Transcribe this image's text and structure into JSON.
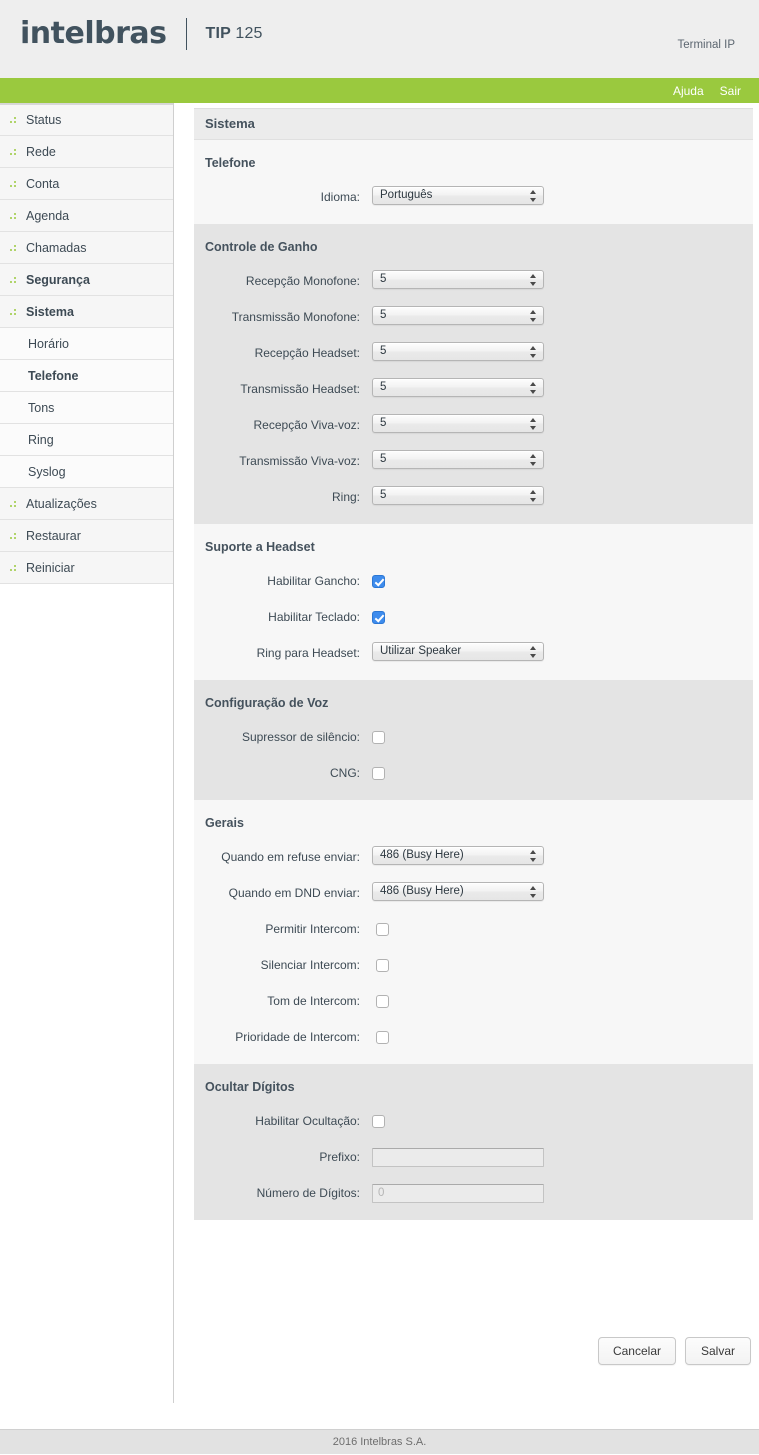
{
  "header": {
    "logo": "intelbras",
    "model_prefix": "TIP",
    "model_number": "125",
    "terminal_label": "Terminal IP"
  },
  "topbar": {
    "help_label": "Ajuda",
    "logout_label": "Sair",
    "accent_color": "#9ac93e"
  },
  "sidebar": {
    "items": [
      {
        "label": "Status",
        "sub": false,
        "active": false
      },
      {
        "label": "Rede",
        "sub": false,
        "active": false
      },
      {
        "label": "Conta",
        "sub": false,
        "active": false
      },
      {
        "label": "Agenda",
        "sub": false,
        "active": false
      },
      {
        "label": "Chamadas",
        "sub": false,
        "active": false
      },
      {
        "label": "Segurança",
        "sub": false,
        "active": true
      },
      {
        "label": "Sistema",
        "sub": false,
        "active": true
      },
      {
        "label": "Horário",
        "sub": true,
        "active": false
      },
      {
        "label": "Telefone",
        "sub": true,
        "active": true
      },
      {
        "label": "Tons",
        "sub": true,
        "active": false
      },
      {
        "label": "Ring",
        "sub": true,
        "active": false
      },
      {
        "label": "Syslog",
        "sub": true,
        "active": false
      },
      {
        "label": "Atualizações",
        "sub": false,
        "active": false
      },
      {
        "label": "Restaurar",
        "sub": false,
        "active": false
      },
      {
        "label": "Reiniciar",
        "sub": false,
        "active": false
      }
    ]
  },
  "panel": {
    "title": "Sistema"
  },
  "sections": {
    "telefone": {
      "heading": "Telefone",
      "idioma_label": "Idioma:",
      "idioma_value": "Português"
    },
    "ganho": {
      "heading": "Controle de Ganho",
      "rows": [
        {
          "label": "Recepção Monofone:",
          "value": "5"
        },
        {
          "label": "Transmissão Monofone:",
          "value": "5"
        },
        {
          "label": "Recepção Headset:",
          "value": "5"
        },
        {
          "label": "Transmissão Headset:",
          "value": "5"
        },
        {
          "label": "Recepção Viva-voz:",
          "value": "5"
        },
        {
          "label": "Transmissão Viva-voz:",
          "value": "5"
        },
        {
          "label": "Ring:",
          "value": "5"
        }
      ]
    },
    "headset": {
      "heading": "Suporte a Headset",
      "gancho_label": "Habilitar Gancho:",
      "gancho_checked": true,
      "teclado_label": "Habilitar Teclado:",
      "teclado_checked": true,
      "ring_label": "Ring para Headset:",
      "ring_value": "Utilizar Speaker"
    },
    "voz": {
      "heading": "Configuração de Voz",
      "supressor_label": "Supressor de silêncio:",
      "supressor_checked": false,
      "cng_label": "CNG:",
      "cng_checked": false
    },
    "gerais": {
      "heading": "Gerais",
      "refuse_label": "Quando em refuse enviar:",
      "refuse_value": "486 (Busy Here)",
      "dnd_label": "Quando em DND enviar:",
      "dnd_value": "486 (Busy Here)",
      "permitir_label": "Permitir Intercom:",
      "permitir_checked": false,
      "silenciar_label": "Silenciar Intercom:",
      "silenciar_checked": false,
      "tom_label": "Tom de Intercom:",
      "tom_checked": false,
      "prioridade_label": "Prioridade de Intercom:",
      "prioridade_checked": false
    },
    "ocultar": {
      "heading": "Ocultar Dígitos",
      "habilitar_label": "Habilitar Ocultação:",
      "habilitar_checked": false,
      "prefixo_label": "Prefixo:",
      "prefixo_value": "",
      "prefixo_placeholder": "",
      "digitos_label": "Número de Dígitos:",
      "digitos_value": "",
      "digitos_placeholder": "0"
    }
  },
  "actions": {
    "cancel_label": "Cancelar",
    "save_label": "Salvar"
  },
  "footer": {
    "copyright": "2016 Intelbras S.A."
  }
}
